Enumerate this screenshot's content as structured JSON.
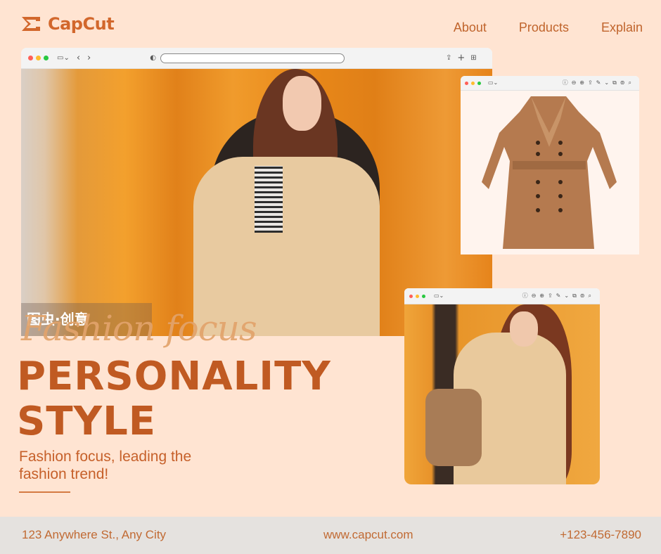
{
  "brand": {
    "name": "CapCut"
  },
  "nav": {
    "items": [
      "About",
      "Products",
      "Explain"
    ]
  },
  "windows": {
    "main": {
      "toolbar_icons": [
        "sidebar-icon",
        "back-icon",
        "forward-icon",
        "shield-icon",
        "share-icon",
        "new-tab-icon",
        "tabs-grid-icon"
      ]
    },
    "coat": {
      "toolbar_icons": [
        "sidebar-icon",
        "info-icon",
        "zoom-out-icon",
        "zoom-in-icon",
        "share-icon",
        "markup-icon",
        "crop-icon",
        "search-icon"
      ]
    },
    "bag": {
      "toolbar_icons": [
        "sidebar-icon",
        "info-icon",
        "zoom-out-icon",
        "zoom-in-icon",
        "share-icon",
        "markup-icon",
        "crop-icon",
        "search-icon"
      ]
    }
  },
  "watermark": {
    "text": "图虫·创意"
  },
  "hero": {
    "script_title": "Fashion focus",
    "headline_line1": "PERSONALITY",
    "headline_line2": "STYLE",
    "subtitle": "Fashion focus, leading the fashion trend!"
  },
  "footer": {
    "address": "123 Anywhere St., Any City",
    "website": "www.capcut.com",
    "phone": "+123-456-7890"
  },
  "colors": {
    "background": "#ffe4d2",
    "accent": "#c05a22",
    "footer_bg": "#e5e2df"
  }
}
